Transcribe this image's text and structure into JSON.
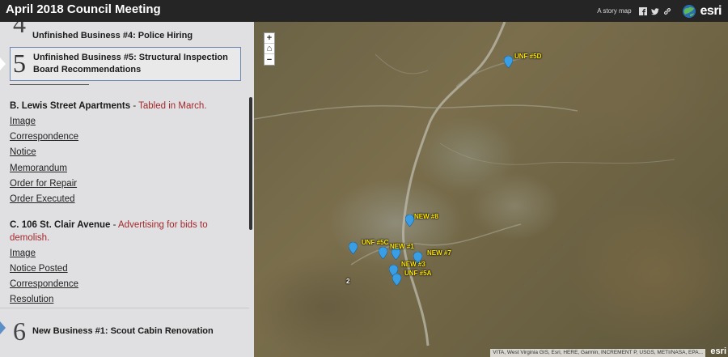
{
  "header": {
    "title": "April 2018 Council Meeting",
    "story_label": "A story map",
    "brand": "esri"
  },
  "sections": {
    "prev": {
      "number": "4",
      "title": "Unfinished Business #4: Police Hiring"
    },
    "current": {
      "number": "5",
      "title_line1": "Unfinished Business #5: Structural Inspection",
      "title_line2": "Board Recommendations"
    },
    "next": {
      "number": "6",
      "title": "New Business #1: Scout Cabin Renovation"
    }
  },
  "items": [
    {
      "heading": "B. Lewis Street Apartments",
      "separator": " - ",
      "note": "Tabled in March.",
      "links": [
        "Image",
        "Correspondence",
        "Notice",
        "Memorandum",
        "Order for Repair",
        "Order Executed"
      ]
    },
    {
      "heading": "C. 106 St. Clair Avenue",
      "separator": " - ",
      "note_line1": "Advertising for bids to",
      "note_line2": "demolish.",
      "links": [
        "Image",
        "Notice Posted",
        "Correspondence",
        "Resolution"
      ]
    }
  ],
  "map": {
    "zoom_in": "+",
    "home": "⌂",
    "zoom_out": "−",
    "attribution": "VITA, West Virginia GIS, Esri, HERE, Garmin, INCREMENT P, USGS, METI/NASA, EPA...",
    "powered": "esri",
    "cluster_label": "2",
    "pin_color": "#3a9ee4",
    "markers": [
      {
        "label": "UNF #5D"
      },
      {
        "label": "NEW #8"
      },
      {
        "label": "UNF #5C"
      },
      {
        "label": "NEW #1"
      },
      {
        "label": "NEW #7"
      },
      {
        "label": "NEW #3"
      },
      {
        "label": "UNF #5A"
      }
    ]
  }
}
